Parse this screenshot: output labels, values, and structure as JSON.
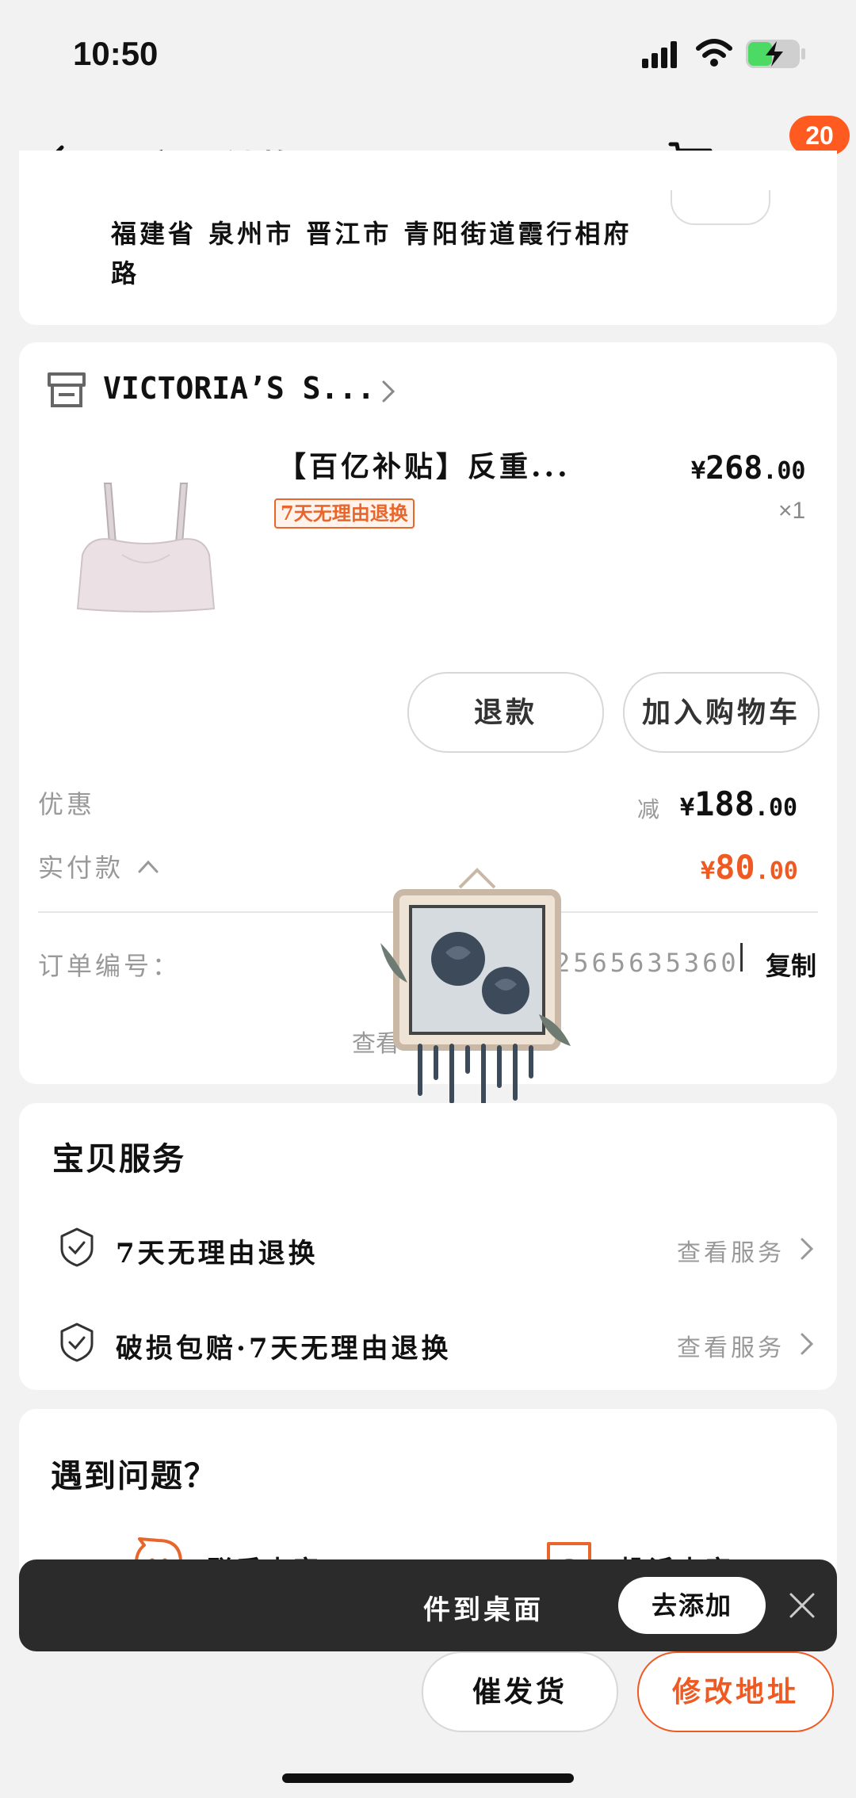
{
  "status_bar": {
    "time": "10:50"
  },
  "nav": {
    "title": "买家已付款",
    "badge_count": "20"
  },
  "address": {
    "text": "福建省 泉州市 晋江市 青阳街道霞行相府路"
  },
  "store": {
    "name": "VICTORIA’S S..."
  },
  "product": {
    "title": "【百亿补贴】反重...",
    "price_symbol": "¥",
    "price_int": "268",
    "price_dec": ".00",
    "tag": "7天无理由退换",
    "quantity": "×1"
  },
  "actions": {
    "refund": "退款",
    "add_to_cart": "加入购物车"
  },
  "summary": {
    "discount_label": "优惠",
    "discount_prefix": "减",
    "discount_symbol": "¥",
    "discount_int": "188",
    "discount_dec": ".00",
    "paid_label": "实付款",
    "paid_symbol": "¥",
    "paid_int": "80",
    "paid_dec": ".00"
  },
  "order": {
    "number_label": "订单编号：",
    "number_value": "2565635360",
    "copy_label": "复制",
    "view_more": "查看"
  },
  "services": {
    "title": "宝贝服务",
    "items": [
      {
        "label": "7天无理由退换",
        "link": "查看服务"
      },
      {
        "label": "破损包赔·7天无理由退换",
        "link": "查看服务"
      }
    ]
  },
  "help": {
    "title": "遇到问题？",
    "contact_seller": "联系卖家",
    "complain_seller": "投诉卖家"
  },
  "toast": {
    "text": "件到桌面",
    "button": "去添加"
  },
  "bottom": {
    "remind_ship": "催发货",
    "modify_address": "修改地址"
  },
  "colors": {
    "accent": "#ef5a23",
    "badge": "#ff5a1f",
    "toast_bg": "#2b2b2b"
  }
}
